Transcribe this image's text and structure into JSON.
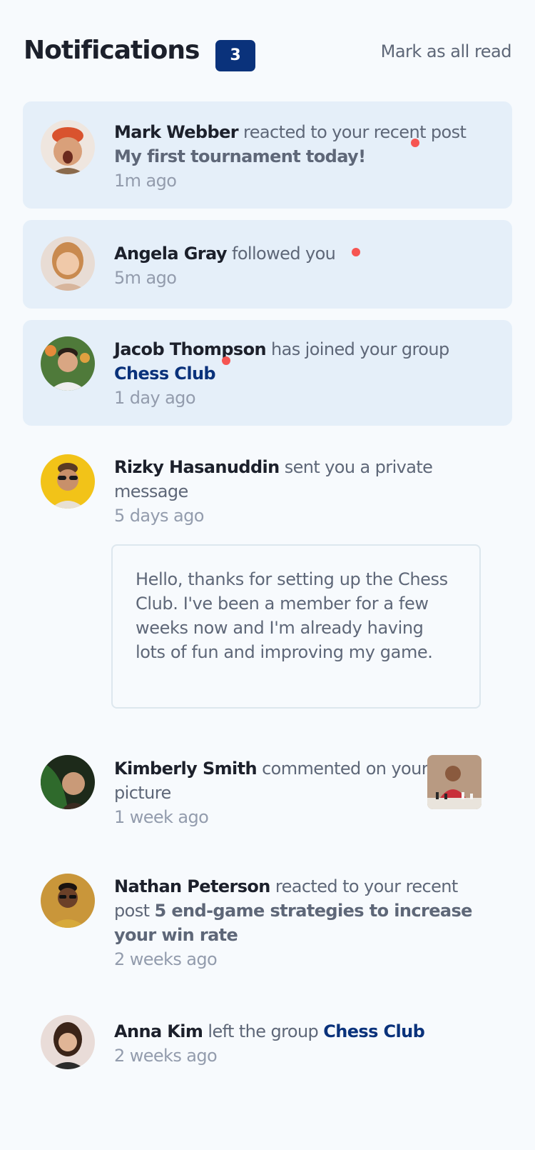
{
  "header": {
    "title": "Notifications",
    "unread_count": "3",
    "mark_all_label": "Mark as all read"
  },
  "notifications": [
    {
      "name": "Mark Webber",
      "action": "reacted to your recent post",
      "object": "My first tournament today!",
      "time": "1m ago",
      "unread": true
    },
    {
      "name": "Angela Gray",
      "action": "followed you",
      "time": "5m ago",
      "unread": true
    },
    {
      "name": "Jacob Thompson",
      "action": "has joined your group",
      "object": "Chess Club",
      "time": "1 day ago",
      "unread": true
    },
    {
      "name": "Rizky Hasanuddin",
      "action": "sent you a private message",
      "time": "5 days ago",
      "unread": false,
      "message": "Hello, thanks for setting up the Chess Club. I've been a member for a few weeks now and I'm already having lots of fun and improving my game."
    },
    {
      "name": "Kimberly Smith",
      "action": "commented on your picture",
      "time": "1 week ago",
      "unread": false
    },
    {
      "name": "Nathan Peterson",
      "action": "reacted to your recent post",
      "object": "5 end-game strategies to increase your win rate",
      "time": "2 weeks ago",
      "unread": false
    },
    {
      "name": "Anna Kim",
      "action": "left the group",
      "object": "Chess Club",
      "time": "2 weeks ago",
      "unread": false
    }
  ],
  "colors": {
    "unread_bg": "#e5eff9",
    "badge": "#0a327b",
    "dot": "#f65552",
    "heading": "#1c202b"
  }
}
